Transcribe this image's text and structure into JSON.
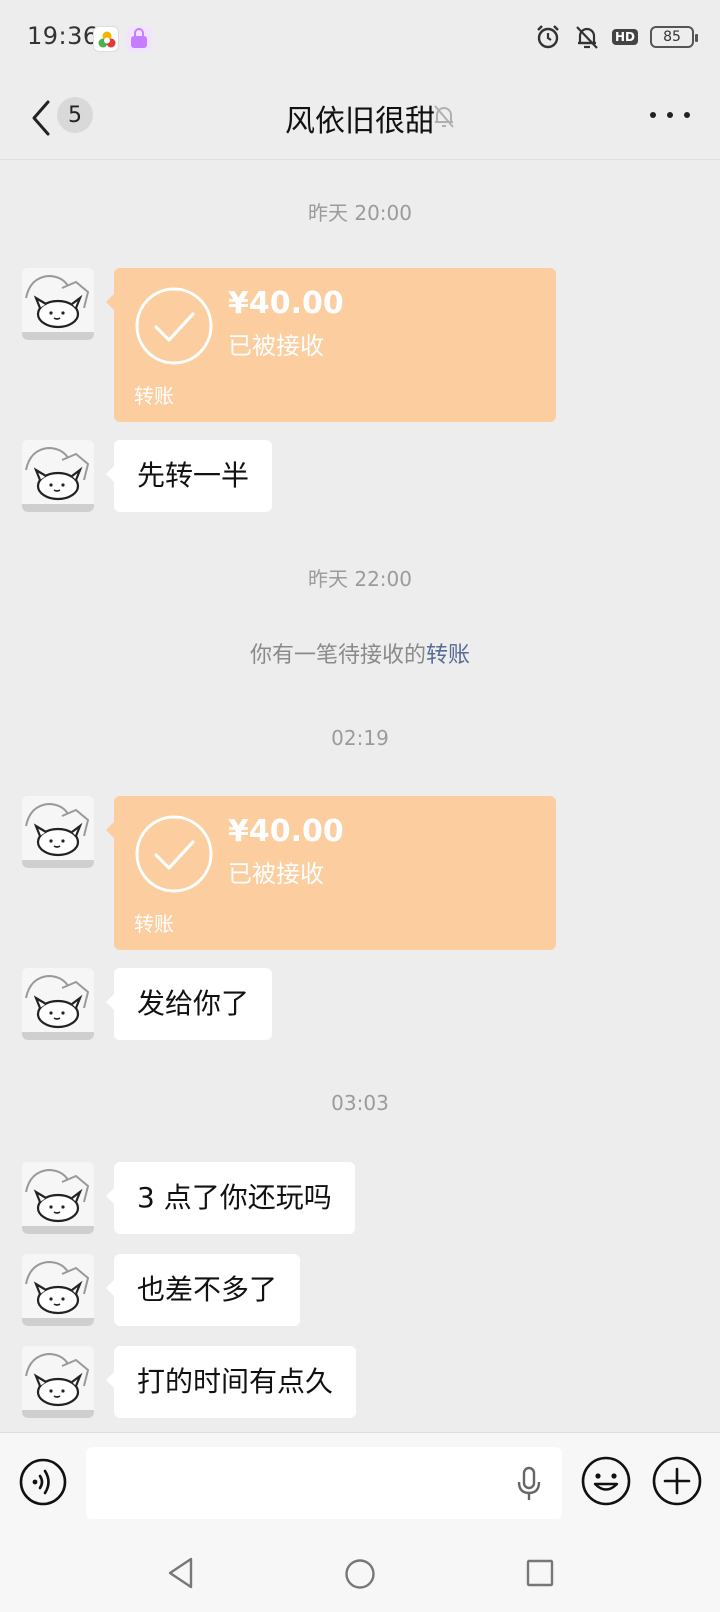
{
  "status_bar": {
    "time": "19:36",
    "battery": "85",
    "hd_label": "HD"
  },
  "title_bar": {
    "unread_count": "5",
    "title": "风依旧很甜",
    "muted": true
  },
  "messages": [
    {
      "kind": "timestamp",
      "text": "昨天 20:00"
    },
    {
      "kind": "transfer",
      "amount": "¥40.00",
      "status": "已被接收",
      "label": "转账"
    },
    {
      "kind": "text",
      "text": "先转一半"
    },
    {
      "kind": "timestamp",
      "text": "昨天 22:00"
    },
    {
      "kind": "system",
      "text": "你有一笔待接收的",
      "link": "转账"
    },
    {
      "kind": "timestamp",
      "text": "02:19"
    },
    {
      "kind": "transfer",
      "amount": "¥40.00",
      "status": "已被接收",
      "label": "转账"
    },
    {
      "kind": "text",
      "text": "发给你了"
    },
    {
      "kind": "timestamp",
      "text": "03:03"
    },
    {
      "kind": "text",
      "text": "3 点了你还玩吗"
    },
    {
      "kind": "text",
      "text": "也差不多了"
    },
    {
      "kind": "text",
      "text": "打的时间有点久"
    }
  ],
  "input_bar": {
    "placeholder": ""
  },
  "colors": {
    "background": "#ededed",
    "transfer_bubble": "#fbcd9f",
    "link": "#576b95"
  }
}
